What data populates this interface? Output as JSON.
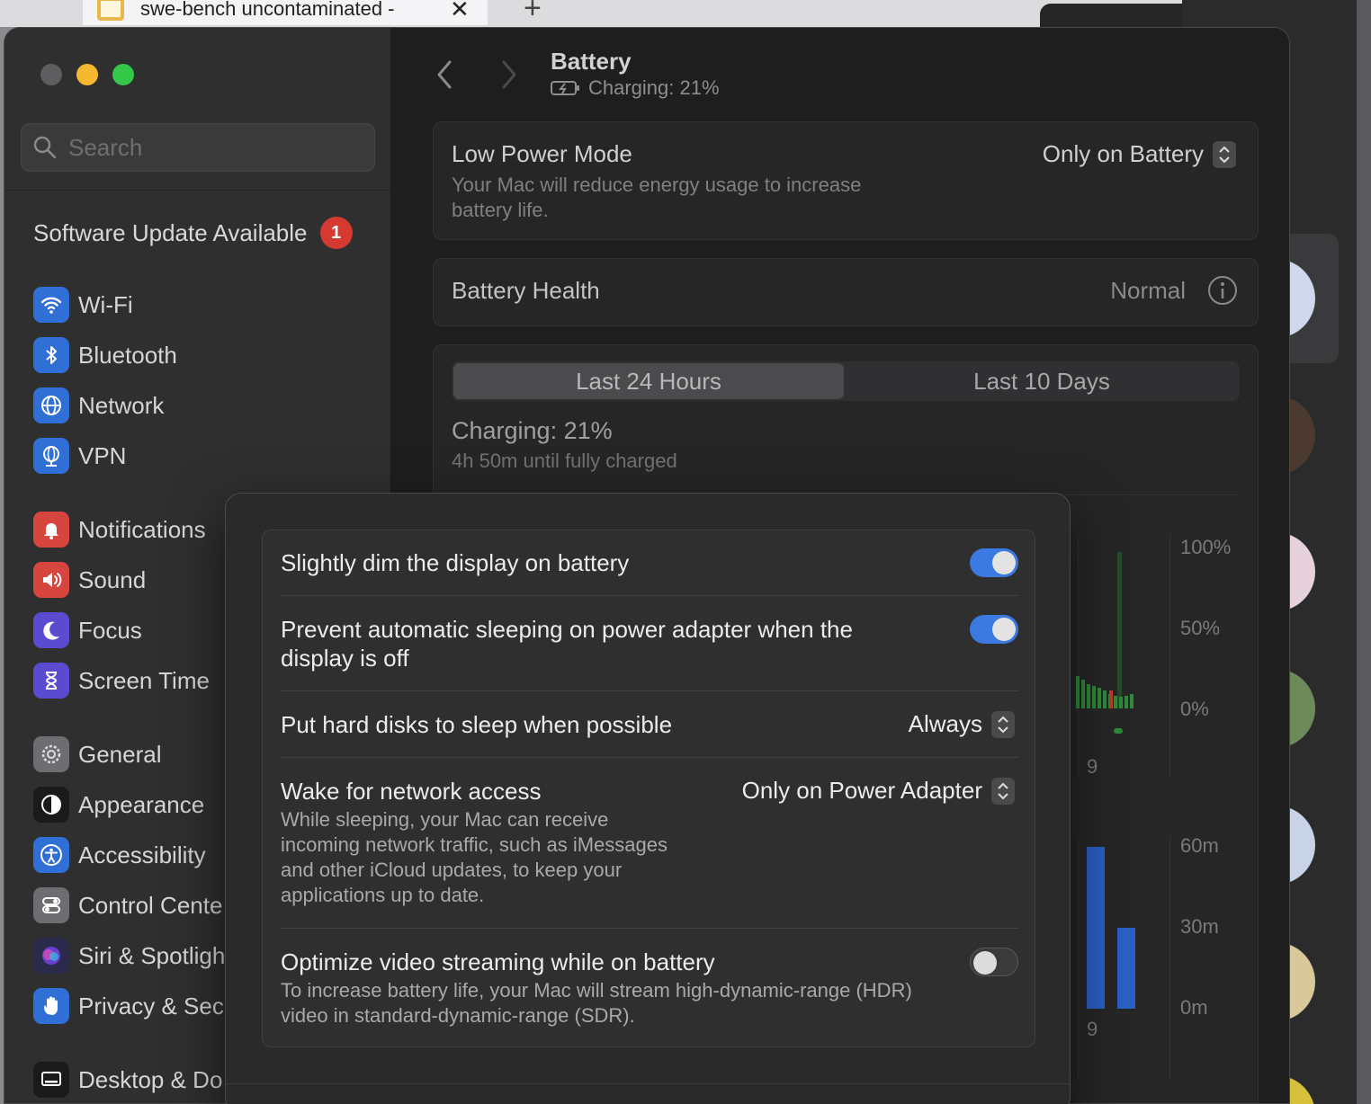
{
  "browser": {
    "tab_title": "swe-bench uncontaminated -",
    "close_glyph": "✕",
    "new_tab_glyph": "+"
  },
  "sidebar": {
    "search_placeholder": "Search",
    "update_label": "Software Update Available",
    "update_badge": "1",
    "items": [
      {
        "label": "Wi-Fi",
        "icon": "wifi-icon",
        "color": "#2f6fd6"
      },
      {
        "label": "Bluetooth",
        "icon": "bluetooth-icon",
        "color": "#2f6fd6"
      },
      {
        "label": "Network",
        "icon": "globe-icon",
        "color": "#2f6fd6"
      },
      {
        "label": "VPN",
        "icon": "vpn-globe-icon",
        "color": "#2f6fd6"
      },
      {
        "label": "Notifications",
        "icon": "bell-icon",
        "color": "#d6463f"
      },
      {
        "label": "Sound",
        "icon": "speaker-icon",
        "color": "#d6463f"
      },
      {
        "label": "Focus",
        "icon": "moon-icon",
        "color": "#5b4bd0"
      },
      {
        "label": "Screen Time",
        "icon": "hourglass-icon",
        "color": "#5b4bd0"
      },
      {
        "label": "General",
        "icon": "gear-icon",
        "color": "#6e6e72"
      },
      {
        "label": "Appearance",
        "icon": "appearance-icon",
        "color": "#1a1a1a"
      },
      {
        "label": "Accessibility",
        "icon": "accessibility-icon",
        "color": "#2f6fd6"
      },
      {
        "label": "Control Cente",
        "icon": "switches-icon",
        "color": "#6e6e72"
      },
      {
        "label": "Siri & Spotligh",
        "icon": "siri-icon",
        "color": "#2a2a4a"
      },
      {
        "label": "Privacy & Sec",
        "icon": "hand-icon",
        "color": "#2f6fd6"
      },
      {
        "label": "Desktop & Do",
        "icon": "desktop-icon",
        "color": "#1a1a1a"
      }
    ]
  },
  "header": {
    "title": "Battery",
    "subtitle": "Charging: 21%"
  },
  "low_power": {
    "title": "Low Power Mode",
    "description": "Your Mac will reduce energy usage to increase battery life.",
    "value": "Only on Battery"
  },
  "health": {
    "title": "Battery Health",
    "value": "Normal"
  },
  "usage": {
    "tab_24h": "Last 24 Hours",
    "tab_10d": "Last 10 Days",
    "status": "Charging: 21%",
    "time_remaining": "4h 50m until fully charged",
    "level_axis": [
      "100%",
      "50%",
      "0%"
    ],
    "screen_axis": [
      "60m",
      "30m",
      "0m"
    ],
    "x_label_top": "9",
    "x_label_bottom": "9",
    "level_color": "#2e8b3a",
    "screen_color": "#2a5fc4"
  },
  "sheet": {
    "options": [
      {
        "label": "Slightly dim the display on battery",
        "toggle": true
      },
      {
        "label": "Prevent automatic sleeping on power adapter when the display is off",
        "toggle": true
      },
      {
        "label": "Put hard disks to sleep when possible",
        "value": "Always"
      },
      {
        "label": "Wake for network access",
        "value": "Only on Power Adapter",
        "description": "While sleeping, your Mac can receive incoming network traffic, such as iMessages and other iCloud updates, to keep your applications up to date."
      },
      {
        "label": "Optimize video streaming while on battery",
        "toggle": false,
        "description": "To increase battery life, your Mac will stream high-dynamic-range (HDR) video in standard-dynamic-range (SDR)."
      }
    ]
  },
  "colors": {
    "accent": "#3b7ae0",
    "badge": "#d53a30"
  }
}
